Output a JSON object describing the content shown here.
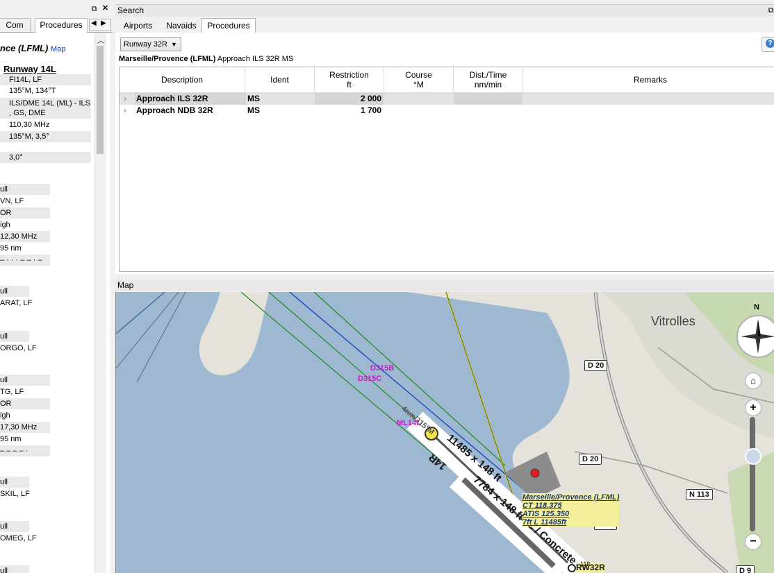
{
  "left_panel": {
    "tabs": [
      "Com",
      "Procedures"
    ],
    "airport_title": "nce (LFML)",
    "map_link": "Map",
    "runway_heading": "Runway 14L",
    "rows": [
      {
        "text": "FI14L, LF",
        "shade": true
      },
      {
        "text": "135°M, 134°T",
        "shade": false
      },
      {
        "text": "ILS/DME 14L (ML) - ILS",
        "shade": true
      },
      {
        "text": ", GS, DME",
        "shade": true
      },
      {
        "text": "110,30 MHz",
        "shade": false
      },
      {
        "text": "135°M, 3,5°",
        "shade": true
      },
      {
        "text": "3,0°",
        "shade": true
      }
    ],
    "groups": [
      {
        "rows": [
          "ull",
          "VN, LF",
          "OR",
          "igh",
          "12,30 MHz",
          "95 nm",
          "– · · · – – · –"
        ]
      },
      {
        "rows": [
          "ull",
          "ARAT, LF"
        ]
      },
      {
        "rows": [
          "ull",
          "ORGO, LF"
        ]
      },
      {
        "rows": [
          "ull",
          "TG, LF",
          "OR",
          "igh",
          "17,30 MHz",
          "95 nm",
          "– – – – ·"
        ]
      },
      {
        "rows": [
          "ull",
          "SKIL, LF"
        ]
      },
      {
        "rows": [
          "ull",
          "OMEG, LF"
        ]
      },
      {
        "rows": [
          "ull"
        ]
      }
    ]
  },
  "search": {
    "title": "Search",
    "tabs": [
      "Airports",
      "Navaids",
      "Procedures"
    ],
    "runway_select": "Runway 32R",
    "header_bold": "Marseille/Provence (LFML)",
    "header_rest": " Approach ILS 32R MS",
    "columns": [
      "Description",
      "Ident",
      "Restriction\nft",
      "Course\n°M",
      "Dist./Time\nnm/min",
      "Remarks"
    ],
    "rows": [
      {
        "description": "Approach ILS 32R",
        "ident": "MS",
        "restriction": "2 000",
        "course": "",
        "dist": "",
        "remarks": "",
        "selected": true
      },
      {
        "description": "Approach NDB 32R",
        "ident": "MS",
        "restriction": "1 700",
        "course": "",
        "dist": "",
        "remarks": "",
        "selected": false
      }
    ]
  },
  "map": {
    "title": "Map",
    "town": "Vitrolles",
    "roads": [
      "D 20",
      "D 20",
      "D 20",
      "N 113",
      "D 9"
    ],
    "waypoints": [
      "D315B",
      "D315C",
      "ML14L"
    ],
    "approach_label": "4nm/315°M",
    "runway_labels": [
      "14R",
      "11485 x 148 ft",
      "7784 x 148 ft / L / Concrete",
      "RW32R",
      "11ft"
    ],
    "airport_info": [
      "Marseille/Provence (LFML)",
      "CT 118.375",
      "ATIS 125.350",
      "7ft L 11485ft"
    ],
    "compass_north": "N",
    "colors": {
      "water": "#9fb8d2",
      "land": "#e4e2da",
      "green": "#c2d8a7",
      "approach_line": "#1a8a1a",
      "waypoint": "#c020c0"
    }
  }
}
